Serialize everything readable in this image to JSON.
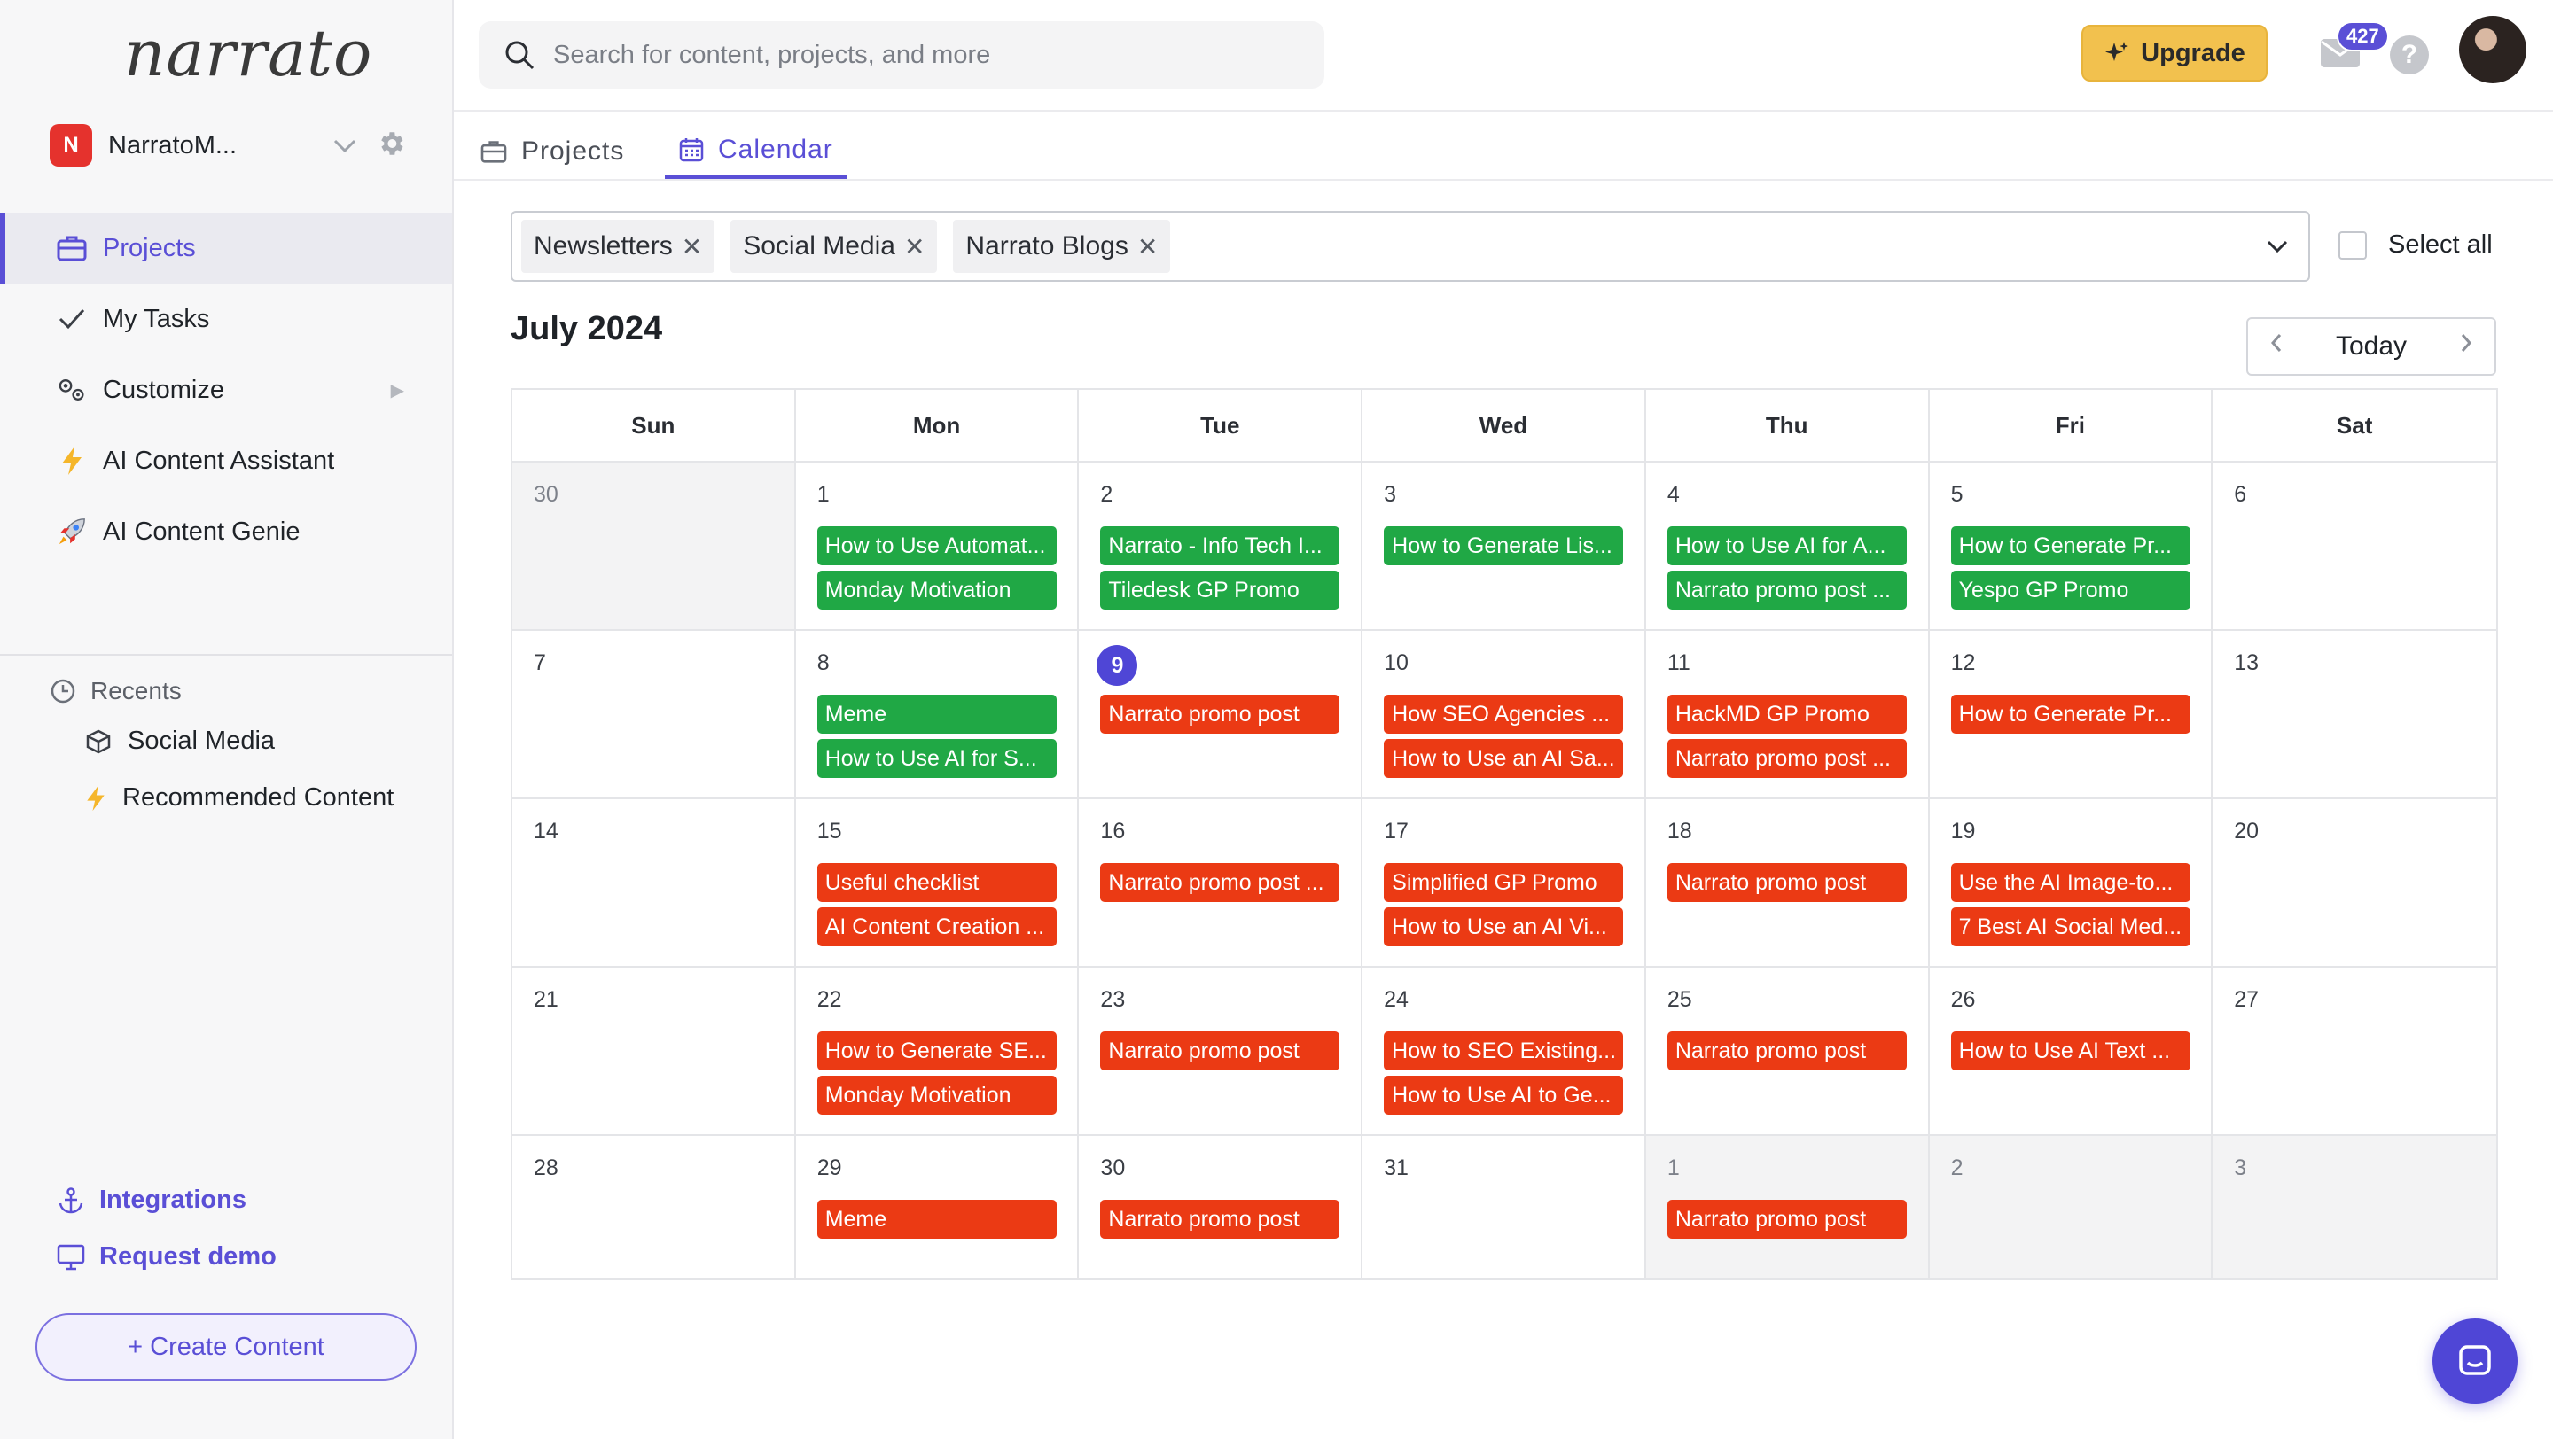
{
  "brand": {
    "logo_text": "narrato"
  },
  "workspace": {
    "initial": "N",
    "name": "NarratoM..."
  },
  "sidebar": {
    "nav": [
      {
        "label": "Projects",
        "icon": "briefcase-icon",
        "active": true
      },
      {
        "label": "My Tasks",
        "icon": "checkmark-icon"
      },
      {
        "label": "Customize",
        "icon": "gears-icon"
      },
      {
        "label": "AI Content Assistant",
        "icon": "lightning-icon"
      },
      {
        "label": "AI Content Genie",
        "icon": "rocket-icon"
      }
    ],
    "recents_title": "Recents",
    "recents": [
      {
        "label": "Social Media",
        "icon": "cube-icon"
      },
      {
        "label": "Recommended Content",
        "icon": "lightning-icon"
      }
    ],
    "integrations": "Integrations",
    "request_demo": "Request demo",
    "create_content": "+ Create Content"
  },
  "topbar": {
    "search_placeholder": "Search for content, projects, and more",
    "upgrade": "Upgrade",
    "mail_count": "427",
    "help": "?"
  },
  "tabs": [
    {
      "label": "Projects",
      "active": false
    },
    {
      "label": "Calendar",
      "active": true
    }
  ],
  "filters": {
    "chips": [
      "Newsletters",
      "Social Media",
      "Narrato Blogs"
    ],
    "select_all": "Select all"
  },
  "calendar": {
    "month_label": "July 2024",
    "today_button": "Today",
    "weekdays": [
      "Sun",
      "Mon",
      "Tue",
      "Wed",
      "Thu",
      "Fri",
      "Sat"
    ],
    "weeks": [
      [
        {
          "num": "30",
          "muted": true,
          "events": []
        },
        {
          "num": "1",
          "events": [
            {
              "title": "How to Use Automat...",
              "color": "green"
            },
            {
              "title": "Monday Motivation",
              "color": "green"
            }
          ]
        },
        {
          "num": "2",
          "events": [
            {
              "title": "Narrato - Info Tech I...",
              "color": "green"
            },
            {
              "title": "Tiledesk GP Promo",
              "color": "green"
            }
          ]
        },
        {
          "num": "3",
          "events": [
            {
              "title": "How to Generate Lis...",
              "color": "green"
            }
          ]
        },
        {
          "num": "4",
          "events": [
            {
              "title": "How to Use AI for A...",
              "color": "green"
            },
            {
              "title": "Narrato promo post ...",
              "color": "green"
            }
          ]
        },
        {
          "num": "5",
          "events": [
            {
              "title": "How to Generate Pr...",
              "color": "green"
            },
            {
              "title": "Yespo GP Promo",
              "color": "green"
            }
          ]
        },
        {
          "num": "6",
          "events": []
        }
      ],
      [
        {
          "num": "7",
          "events": []
        },
        {
          "num": "8",
          "events": [
            {
              "title": "Meme",
              "color": "green"
            },
            {
              "title": "How to Use AI for S...",
              "color": "green"
            }
          ]
        },
        {
          "num": "9",
          "today": true,
          "events": [
            {
              "title": "Narrato promo post",
              "color": "red"
            }
          ]
        },
        {
          "num": "10",
          "events": [
            {
              "title": "How SEO Agencies ...",
              "color": "red"
            },
            {
              "title": "How to Use an AI Sa...",
              "color": "red"
            }
          ]
        },
        {
          "num": "11",
          "events": [
            {
              "title": "HackMD GP Promo",
              "color": "red"
            },
            {
              "title": "Narrato promo post ...",
              "color": "red"
            }
          ]
        },
        {
          "num": "12",
          "events": [
            {
              "title": "How to Generate Pr...",
              "color": "red"
            }
          ]
        },
        {
          "num": "13",
          "events": []
        }
      ],
      [
        {
          "num": "14",
          "events": []
        },
        {
          "num": "15",
          "events": [
            {
              "title": "Useful checklist",
              "color": "red"
            },
            {
              "title": "AI Content Creation ...",
              "color": "red"
            }
          ]
        },
        {
          "num": "16",
          "events": [
            {
              "title": "Narrato promo post ...",
              "color": "red"
            }
          ]
        },
        {
          "num": "17",
          "events": [
            {
              "title": "Simplified GP Promo",
              "color": "red"
            },
            {
              "title": "How to Use an AI Vi...",
              "color": "red"
            }
          ]
        },
        {
          "num": "18",
          "events": [
            {
              "title": "Narrato promo post",
              "color": "red"
            }
          ]
        },
        {
          "num": "19",
          "events": [
            {
              "title": "Use the AI Image-to...",
              "color": "red"
            },
            {
              "title": "7 Best AI Social Med...",
              "color": "red"
            }
          ]
        },
        {
          "num": "20",
          "events": []
        }
      ],
      [
        {
          "num": "21",
          "events": []
        },
        {
          "num": "22",
          "events": [
            {
              "title": "How to Generate SE...",
              "color": "red"
            },
            {
              "title": "Monday Motivation",
              "color": "red"
            }
          ]
        },
        {
          "num": "23",
          "events": [
            {
              "title": "Narrato promo post",
              "color": "red"
            }
          ]
        },
        {
          "num": "24",
          "events": [
            {
              "title": "How to SEO Existing...",
              "color": "red"
            },
            {
              "title": "How to Use AI to Ge...",
              "color": "red"
            }
          ]
        },
        {
          "num": "25",
          "events": [
            {
              "title": "Narrato promo post",
              "color": "red"
            }
          ]
        },
        {
          "num": "26",
          "events": [
            {
              "title": "How to Use AI Text ...",
              "color": "red"
            }
          ]
        },
        {
          "num": "27",
          "events": []
        }
      ],
      [
        {
          "num": "28",
          "events": []
        },
        {
          "num": "29",
          "events": [
            {
              "title": "Meme",
              "color": "red"
            }
          ]
        },
        {
          "num": "30",
          "events": [
            {
              "title": "Narrato promo post",
              "color": "red"
            }
          ]
        },
        {
          "num": "31",
          "events": []
        },
        {
          "num": "1",
          "muted": true,
          "events": [
            {
              "title": "Narrato promo post",
              "color": "red"
            }
          ]
        },
        {
          "num": "2",
          "muted": true,
          "events": []
        },
        {
          "num": "3",
          "muted": true,
          "events": []
        }
      ]
    ]
  },
  "colors": {
    "accent": "#5a4fd6",
    "event_green": "#20a845",
    "event_red": "#eb3a14",
    "upgrade": "#f2c14e"
  }
}
